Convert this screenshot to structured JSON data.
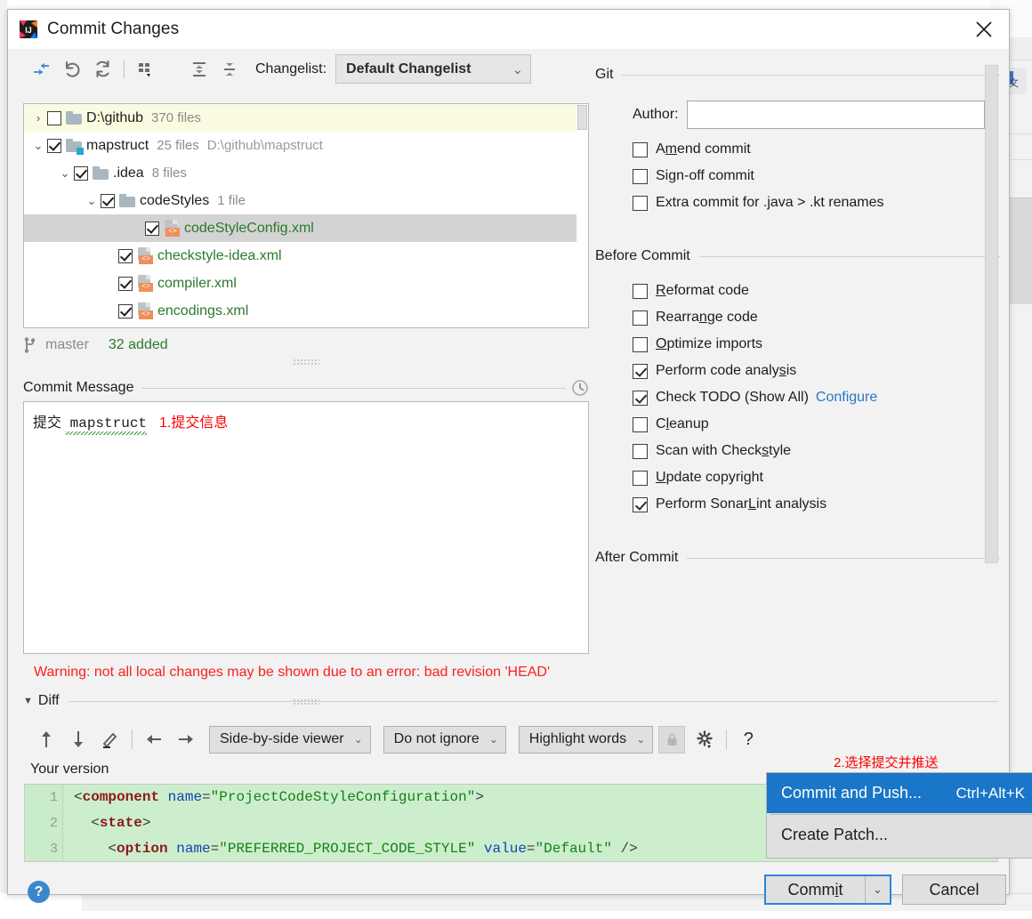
{
  "window": {
    "title": "Commit Changes",
    "logo_icon": "intellij-idea-logo",
    "close_icon": "close-icon"
  },
  "toolbar": {
    "icons": [
      {
        "name": "collapse-to-selection-icon",
        "title": "Collapse"
      },
      {
        "name": "rollback-icon",
        "title": "Rollback"
      },
      {
        "name": "refresh-icon",
        "title": "Refresh"
      },
      {
        "name": "group-by-icon",
        "title": "Group By"
      },
      {
        "name": "expand-all-icon",
        "title": "Expand All"
      },
      {
        "name": "collapse-all-icon",
        "title": "Collapse All"
      }
    ],
    "changelist_label": "Changelist:",
    "changelist_value": "Default Changelist",
    "chevron": "⌄"
  },
  "tree": {
    "rows": [
      {
        "twisty": "›",
        "checked": false,
        "icon": "folder-icon",
        "name": "D:\\github",
        "meta": "370 files",
        "path": "",
        "indent": 6,
        "state": "highlight",
        "name_color": "dark"
      },
      {
        "twisty": "⌄",
        "checked": true,
        "icon": "folder-modified-icon",
        "name": "mapstruct",
        "meta": "25 files",
        "path": "D:\\github\\mapstruct",
        "indent": 6,
        "state": "normal",
        "name_color": "dark"
      },
      {
        "twisty": "⌄",
        "checked": true,
        "icon": "folder-icon",
        "name": ".idea",
        "meta": "8 files",
        "path": "",
        "indent": 36,
        "state": "normal",
        "name_color": "dark"
      },
      {
        "twisty": "⌄",
        "checked": true,
        "icon": "folder-icon",
        "name": "codeStyles",
        "meta": "1 file",
        "path": "",
        "indent": 66,
        "state": "normal",
        "name_color": "dark"
      },
      {
        "twisty": "",
        "checked": true,
        "icon": "xml-file-icon",
        "name": "codeStyleConfig.xml",
        "meta": "",
        "path": "",
        "indent": 116,
        "state": "selected",
        "name_color": "green"
      },
      {
        "twisty": "",
        "checked": true,
        "icon": "xml-file-icon",
        "name": "checkstyle-idea.xml",
        "meta": "",
        "path": "",
        "indent": 86,
        "state": "normal",
        "name_color": "green"
      },
      {
        "twisty": "",
        "checked": true,
        "icon": "xml-file-icon",
        "name": "compiler.xml",
        "meta": "",
        "path": "",
        "indent": 86,
        "state": "normal",
        "name_color": "green"
      },
      {
        "twisty": "",
        "checked": true,
        "icon": "xml-file-icon",
        "name": "encodings.xml",
        "meta": "",
        "path": "",
        "indent": 86,
        "state": "normal",
        "name_color": "green"
      }
    ]
  },
  "branch": {
    "icon": "git-branch-icon",
    "name": "master",
    "status": "32 added"
  },
  "commit_message": {
    "section_title": "Commit Message",
    "history_icon": "clock-history-icon",
    "value": "提交 mapstruct",
    "annotation": "1.提交信息"
  },
  "warning": "Warning: not all local changes may be shown due to an error: bad revision 'HEAD'",
  "git_section": {
    "title": "Git",
    "author_label": "Author:",
    "author_value": "",
    "options": [
      {
        "label_pre": "A",
        "label_mn": "m",
        "label_post": "end commit",
        "checked": false,
        "name": "amend-commit"
      },
      {
        "label_pre": "Si",
        "label_mn": "g",
        "label_post": "n-off commit",
        "checked": false,
        "name": "sign-off-commit"
      },
      {
        "label_pre": "Extra commit for .java > .kt renames",
        "label_mn": "",
        "label_post": "",
        "checked": false,
        "name": "extra-commit-renames"
      }
    ]
  },
  "before_commit": {
    "title": "Before Commit",
    "options": [
      {
        "label_pre": "",
        "label_mn": "R",
        "label_post": "eformat code",
        "checked": false,
        "name": "reformat-code"
      },
      {
        "label_pre": "Rearra",
        "label_mn": "n",
        "label_post": "ge code",
        "checked": false,
        "name": "rearrange-code"
      },
      {
        "label_pre": "",
        "label_mn": "O",
        "label_post": "ptimize imports",
        "checked": false,
        "name": "optimize-imports"
      },
      {
        "label_pre": "Perform code analy",
        "label_mn": "s",
        "label_post": "is",
        "checked": true,
        "name": "perform-code-analysis"
      },
      {
        "label_pre": "Check TODO (Show All)",
        "label_mn": "",
        "label_post": "",
        "checked": true,
        "name": "check-todo",
        "link": "Configure"
      },
      {
        "label_pre": "C",
        "label_mn": "l",
        "label_post": "eanup",
        "checked": false,
        "name": "cleanup"
      },
      {
        "label_pre": "Scan with Check",
        "label_mn": "s",
        "label_post": "tyle",
        "checked": false,
        "name": "scan-with-checkstyle"
      },
      {
        "label_pre": "",
        "label_mn": "U",
        "label_post": "pdate copyright",
        "checked": false,
        "name": "update-copyright"
      },
      {
        "label_pre": "Perform Sonar",
        "label_mn": "L",
        "label_post": "int analysis",
        "checked": true,
        "name": "perform-sonarlint-analysis"
      }
    ]
  },
  "after_commit": {
    "title": "After Commit"
  },
  "diff": {
    "section_title": "Diff",
    "twisty": "▼",
    "nav_icons": [
      {
        "name": "previous-difference-icon",
        "glyph": "↑"
      },
      {
        "name": "next-difference-icon",
        "glyph": "↓"
      },
      {
        "name": "edit-source-icon",
        "glyph": "✎"
      },
      {
        "name": "accept-left-icon",
        "glyph": "←"
      },
      {
        "name": "accept-right-icon",
        "glyph": "→"
      }
    ],
    "viewer_mode": "Side-by-side viewer",
    "ignore_policy": "Do not ignore",
    "highlight_policy": "Highlight words",
    "lock_icon": "lock-icon",
    "settings_icon": "gear-icon",
    "help_icon": "question-mark-icon",
    "pane_label": "Your version",
    "lines": [
      {
        "number": "1",
        "tokens": [
          {
            "t": "punct",
            "v": "<"
          },
          {
            "t": "tag",
            "v": "component"
          },
          {
            "t": "punct",
            "v": " "
          },
          {
            "t": "attr",
            "v": "name"
          },
          {
            "t": "punct",
            "v": "="
          },
          {
            "t": "val",
            "v": "\"ProjectCodeStyleConfiguration\""
          },
          {
            "t": "punct",
            "v": ">"
          }
        ]
      },
      {
        "number": "2",
        "tokens": [
          {
            "t": "punct",
            "v": "  <"
          },
          {
            "t": "tag",
            "v": "state"
          },
          {
            "t": "punct",
            "v": ">"
          }
        ]
      },
      {
        "number": "3",
        "tokens": [
          {
            "t": "punct",
            "v": "    <"
          },
          {
            "t": "tag",
            "v": "option"
          },
          {
            "t": "punct",
            "v": " "
          },
          {
            "t": "attr",
            "v": "name"
          },
          {
            "t": "punct",
            "v": "="
          },
          {
            "t": "val",
            "v": "\"PREFERRED_PROJECT_CODE_STYLE\""
          },
          {
            "t": "punct",
            "v": " "
          },
          {
            "t": "attr",
            "v": "value"
          },
          {
            "t": "punct",
            "v": "="
          },
          {
            "t": "val",
            "v": "\"Default\""
          },
          {
            "t": "punct",
            "v": " />"
          }
        ]
      }
    ]
  },
  "popup_menu": {
    "annotation": "2.选择提交并推送",
    "items": [
      {
        "label": "Commit and Push...",
        "shortcut": "Ctrl+Alt+K",
        "selected": true,
        "name": "commit-and-push"
      },
      {
        "label": "Create Patch...",
        "shortcut": "",
        "selected": false,
        "name": "create-patch"
      }
    ]
  },
  "buttons": {
    "help": "?",
    "commit_pre": "Comm",
    "commit_mn": "i",
    "commit_post": "t",
    "commit_arrow": "⌄",
    "cancel": "Cancel"
  }
}
